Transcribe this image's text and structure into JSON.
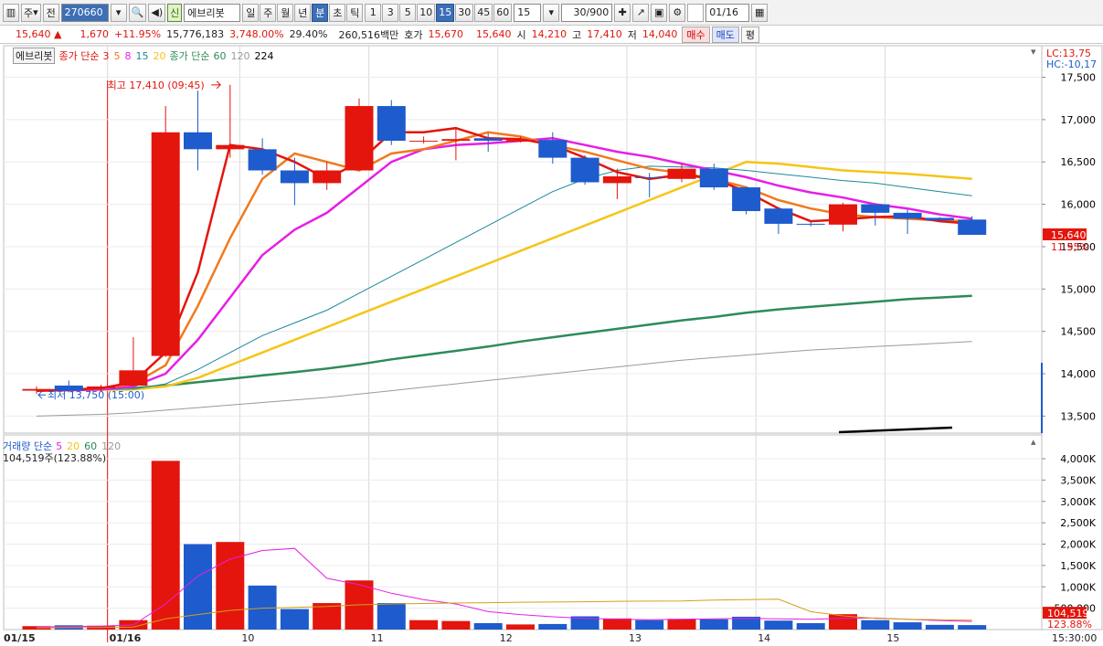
{
  "toolbar": {
    "market_select": "주",
    "scope_button": "전",
    "stock_code": "270660",
    "stock_tag": "신",
    "stock_name": "에브리봇",
    "period_buttons": [
      "일",
      "주",
      "월",
      "년",
      "분",
      "초",
      "틱"
    ],
    "active_period": "분",
    "interval_buttons": [
      "1",
      "3",
      "5",
      "10",
      "15",
      "30",
      "45",
      "60"
    ],
    "active_interval": "15",
    "interval_value": "15",
    "count_value": "30/900",
    "date_value": "01/16"
  },
  "quote": {
    "price": "15,640",
    "change_arrow": "▲",
    "change": "1,670",
    "change_pct": "+11.95%",
    "volume": "15,776,183",
    "vol_ratio": "3,748.00%",
    "turnover_pct": "29.40%",
    "amount": "260,516백만",
    "bid_label": "호가",
    "bid": "15,670",
    "ask": "15,640",
    "open_label": "시",
    "open": "14,210",
    "high_label": "고",
    "high": "17,410",
    "low_label": "저",
    "low": "14,040",
    "buy_button": "매수",
    "sell_button": "매도",
    "extra_button": "평"
  },
  "price_legend": {
    "name": "에브리봇",
    "ma_label": "종가 단순",
    "ma_short": [
      "3",
      "5",
      "8",
      "15",
      "20"
    ],
    "ma_long_label": "종가 단순",
    "ma_long": [
      "60",
      "120",
      "224"
    ]
  },
  "volume_legend": {
    "label": "거래량 단순",
    "ma": [
      "5",
      "20",
      "60",
      "120"
    ],
    "value_text": "104,519주(123.88%)"
  },
  "annotations": {
    "high": "최고 17,410 (09:45)",
    "low": "최저 13,750 (15:00)",
    "lc": "LC:13,75",
    "hc": "HC:-10,17",
    "price_tag": "15,640",
    "pct_tag": "11.95%",
    "vol_tag": "104,519",
    "vol_pct_tag": "123.88%"
  },
  "colors": {
    "up": "#e4150c",
    "down": "#1e5bcc",
    "ma3": "#e4150c",
    "ma5": "#f07a1e",
    "ma8": "#e61ee6",
    "ma15": "#1a8a9a",
    "ma20": "#f5c518",
    "ma60": "#2e8b57",
    "ma120": "#9a9a9a",
    "ma224": "#000000"
  },
  "chart_data": {
    "type": "candlestick",
    "price_axis": {
      "min": 13450,
      "max": 17700,
      "ticks": [
        "17,500",
        "17,000",
        "16,500",
        "16,000",
        "15,500",
        "15,000",
        "14,500",
        "14,000",
        "13,500"
      ]
    },
    "volume_axis": {
      "min": 0,
      "max": 4300000,
      "ticks": [
        "4,000K",
        "3,500K",
        "3,000K",
        "2,500K",
        "2,000K",
        "1,500K",
        "1,000K",
        "500,000"
      ]
    },
    "x_labels": [
      {
        "label": "01/15",
        "slot": 0
      },
      {
        "label": "01/16",
        "slot": 2.7
      },
      {
        "label": "10",
        "slot": 6.8
      },
      {
        "label": "11",
        "slot": 10.8
      },
      {
        "label": "12",
        "slot": 14.8
      },
      {
        "label": "13",
        "slot": 18.8
      },
      {
        "label": "14",
        "slot": 22.8
      },
      {
        "label": "15",
        "slot": 26.8
      },
      {
        "label": "15:30:00",
        "slot": 32.4
      }
    ],
    "candles": [
      {
        "o": 13800,
        "h": 13850,
        "l": 13760,
        "c": 13820,
        "v": 80000
      },
      {
        "o": 13860,
        "h": 13920,
        "l": 13780,
        "c": 13800,
        "v": 100000
      },
      {
        "o": 13830,
        "h": 13870,
        "l": 13790,
        "c": 13850,
        "v": 90000
      },
      {
        "o": 13860,
        "h": 14430,
        "l": 13850,
        "c": 14040,
        "v": 220000
      },
      {
        "o": 14210,
        "h": 17160,
        "l": 14200,
        "c": 16850,
        "v": 3950000
      },
      {
        "o": 16850,
        "h": 17340,
        "l": 16400,
        "c": 16650,
        "v": 2000000
      },
      {
        "o": 16650,
        "h": 17410,
        "l": 16550,
        "c": 16700,
        "v": 2050000
      },
      {
        "o": 16650,
        "h": 16780,
        "l": 16350,
        "c": 16400,
        "v": 1030000
      },
      {
        "o": 16400,
        "h": 16550,
        "l": 15990,
        "c": 16250,
        "v": 480000
      },
      {
        "o": 16250,
        "h": 16500,
        "l": 16170,
        "c": 16400,
        "v": 620000
      },
      {
        "o": 16400,
        "h": 17250,
        "l": 16400,
        "c": 17160,
        "v": 1150000
      },
      {
        "o": 17160,
        "h": 17230,
        "l": 16700,
        "c": 16750,
        "v": 620000
      },
      {
        "o": 16750,
        "h": 16800,
        "l": 16720,
        "c": 16750,
        "v": 220000
      },
      {
        "o": 16750,
        "h": 16900,
        "l": 16520,
        "c": 16770,
        "v": 200000
      },
      {
        "o": 16780,
        "h": 16840,
        "l": 16620,
        "c": 16750,
        "v": 150000
      },
      {
        "o": 16740,
        "h": 16800,
        "l": 16730,
        "c": 16760,
        "v": 120000
      },
      {
        "o": 16760,
        "h": 16850,
        "l": 16480,
        "c": 16550,
        "v": 130000
      },
      {
        "o": 16550,
        "h": 16580,
        "l": 16230,
        "c": 16260,
        "v": 310000
      },
      {
        "o": 16250,
        "h": 16420,
        "l": 16060,
        "c": 16330,
        "v": 260000
      },
      {
        "o": 16320,
        "h": 16370,
        "l": 16080,
        "c": 16310,
        "v": 220000
      },
      {
        "o": 16300,
        "h": 16480,
        "l": 16260,
        "c": 16420,
        "v": 250000
      },
      {
        "o": 16420,
        "h": 16480,
        "l": 16170,
        "c": 16200,
        "v": 240000
      },
      {
        "o": 16200,
        "h": 16210,
        "l": 15880,
        "c": 15920,
        "v": 300000
      },
      {
        "o": 15950,
        "h": 15960,
        "l": 15650,
        "c": 15770,
        "v": 210000
      },
      {
        "o": 15770,
        "h": 15800,
        "l": 15740,
        "c": 15760,
        "v": 150000
      },
      {
        "o": 15760,
        "h": 16020,
        "l": 15680,
        "c": 16000,
        "v": 360000
      },
      {
        "o": 16000,
        "h": 16010,
        "l": 15750,
        "c": 15900,
        "v": 220000
      },
      {
        "o": 15900,
        "h": 15940,
        "l": 15650,
        "c": 15830,
        "v": 170000
      },
      {
        "o": 15840,
        "h": 15850,
        "l": 15800,
        "c": 15810,
        "v": 110000
      },
      {
        "o": 15820,
        "h": 15860,
        "l": 15780,
        "c": 15640,
        "v": 104519
      }
    ],
    "moving_averages": {
      "ma3": [
        13800,
        13810,
        13830,
        13900,
        14250,
        15200,
        16700,
        16650,
        16500,
        16300,
        16500,
        16850,
        16850,
        16900,
        16780,
        16770,
        16700,
        16550,
        16380,
        16300,
        16350,
        16300,
        16150,
        15950,
        15800,
        15820,
        15850,
        15860,
        15800,
        15770
      ],
      "ma5": [
        13800,
        13810,
        13830,
        13880,
        14100,
        14800,
        15600,
        16300,
        16600,
        16500,
        16400,
        16600,
        16650,
        16750,
        16850,
        16800,
        16700,
        16620,
        16520,
        16420,
        16370,
        16300,
        16200,
        16050,
        15950,
        15880,
        15850,
        15830,
        15810,
        15800
      ],
      "ma8": [
        13800,
        13805,
        13815,
        13850,
        14000,
        14400,
        14900,
        15400,
        15700,
        15900,
        16200,
        16500,
        16650,
        16700,
        16720,
        16750,
        16780,
        16700,
        16620,
        16560,
        16480,
        16400,
        16320,
        16220,
        16140,
        16080,
        16000,
        15950,
        15880,
        15830
      ],
      "ma15": [
        13800,
        13805,
        13810,
        13820,
        13880,
        14050,
        14250,
        14450,
        14600,
        14750,
        14950,
        15150,
        15350,
        15550,
        15750,
        15950,
        16150,
        16300,
        16400,
        16450,
        16440,
        16430,
        16400,
        16360,
        16320,
        16280,
        16250,
        16200,
        16150,
        16100
      ],
      "ma20": [
        13800,
        13805,
        13810,
        13815,
        13850,
        13950,
        14100,
        14250,
        14400,
        14550,
        14700,
        14850,
        15000,
        15150,
        15300,
        15450,
        15600,
        15750,
        15900,
        16050,
        16200,
        16350,
        16500,
        16480,
        16440,
        16400,
        16380,
        16360,
        16330,
        16300
      ],
      "ma60": [
        13800,
        13810,
        13820,
        13830,
        13860,
        13900,
        13940,
        13980,
        14020,
        14060,
        14110,
        14170,
        14220,
        14270,
        14320,
        14380,
        14430,
        14480,
        14530,
        14580,
        14630,
        14670,
        14720,
        14760,
        14790,
        14820,
        14850,
        14880,
        14900,
        14920
      ],
      "ma120": [
        13500,
        13510,
        13520,
        13540,
        13570,
        13600,
        13630,
        13660,
        13690,
        13720,
        13760,
        13800,
        13840,
        13880,
        13920,
        13960,
        14000,
        14040,
        14080,
        14120,
        14160,
        14190,
        14220,
        14250,
        14280,
        14300,
        14320,
        14340,
        14360,
        14380
      ],
      "vol_ma5": [
        60000,
        70000,
        80000,
        110000,
        600000,
        1250000,
        1650000,
        1850000,
        1900000,
        1200000,
        1050000,
        850000,
        700000,
        600000,
        420000,
        350000,
        300000,
        260000,
        240000,
        230000,
        240000,
        250000,
        260000,
        250000,
        240000,
        260000,
        270000,
        240000,
        210000,
        190000
      ],
      "vol_ma20": [
        40000,
        45000,
        50000,
        60000,
        250000,
        350000,
        450000,
        500000,
        520000,
        540000,
        580000,
        600000,
        610000,
        620000,
        630000,
        640000,
        645000,
        650000,
        660000,
        665000,
        670000,
        690000,
        700000,
        710000,
        420000,
        320000,
        260000,
        240000,
        230000,
        220000
      ]
    }
  }
}
